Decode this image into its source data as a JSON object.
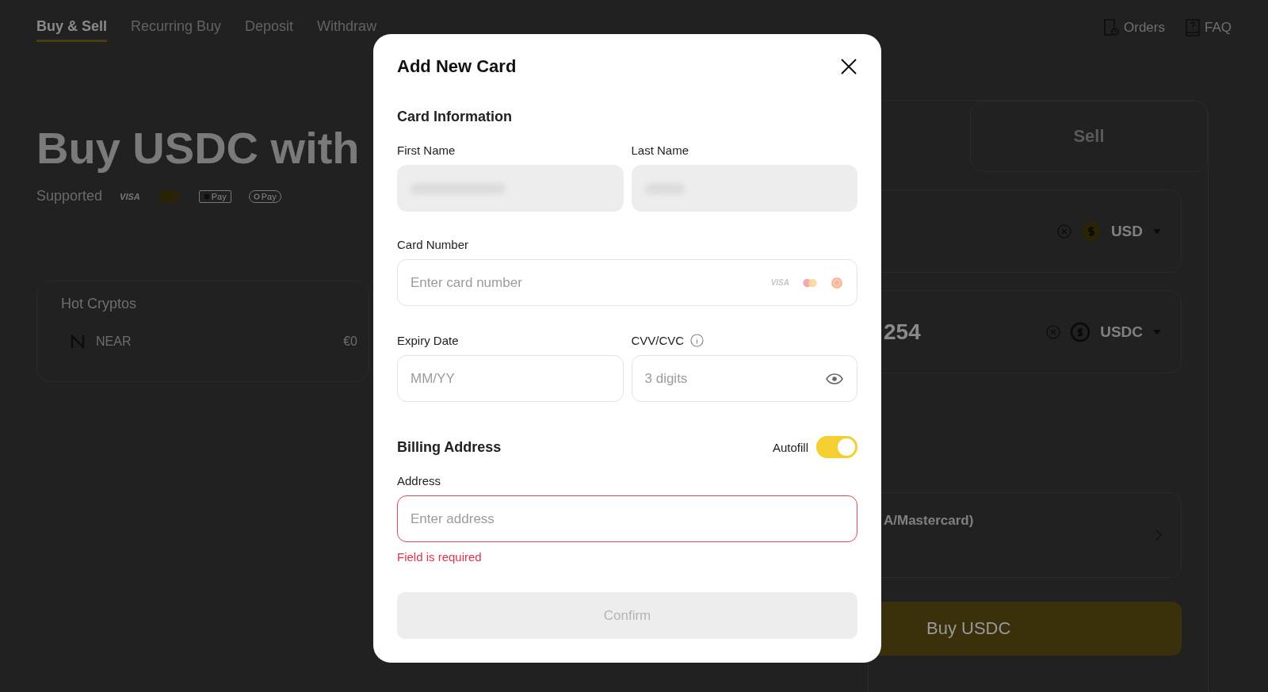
{
  "page": {
    "tabs": [
      {
        "label": "Buy & Sell",
        "selected": true
      },
      {
        "label": "Recurring Buy",
        "selected": false
      },
      {
        "label": "Deposit",
        "selected": false
      },
      {
        "label": "Withdraw",
        "selected": false
      }
    ],
    "top_links": [
      {
        "label": "Orders",
        "kind": "orders"
      },
      {
        "label": "FAQ",
        "kind": "faq"
      }
    ],
    "heading": "Buy USDC with",
    "supported_label": "Supported",
    "payment_logos": [
      {
        "kind": "visa",
        "text": "VISA"
      },
      {
        "kind": "mastercard"
      },
      {
        "kind": "applepay",
        "text": "Pay"
      },
      {
        "kind": "googlepay",
        "text": "Pay"
      }
    ],
    "hot_cryptos": {
      "title": "Hot Cryptos",
      "rows": [
        {
          "name": "NEAR",
          "value": "€0"
        }
      ]
    },
    "trade_panel": {
      "side_tab": "Sell",
      "spend_currency": "USD",
      "receive_amount": "254",
      "receive_currency": "USDC",
      "payment_method": "A/Mastercard)",
      "buy_button": "Buy USDC"
    }
  },
  "modal": {
    "title": "Add New Card",
    "section": "Card Information",
    "first_name": {
      "label": "First Name",
      "filled": true
    },
    "last_name": {
      "label": "Last Name",
      "filled": true
    },
    "card_number": {
      "label": "Card Number",
      "placeholder": "Enter card number",
      "brand_logos": [
        {
          "kind": "visa",
          "text": "VISA"
        },
        {
          "kind": "mastercard"
        },
        {
          "kind": "round"
        }
      ]
    },
    "expiry": {
      "label": "Expiry Date",
      "placeholder": "MM/YY"
    },
    "cvv": {
      "label": "CVV/CVC",
      "placeholder": "3 digits"
    },
    "billing": {
      "title": "Billing Address",
      "autofill": {
        "label": "Autofill",
        "on": true
      }
    },
    "address": {
      "label": "Address",
      "placeholder": "Enter address",
      "error": true,
      "error_text": "Field is required"
    },
    "confirm": {
      "label": "Confirm",
      "disabled": true
    }
  }
}
